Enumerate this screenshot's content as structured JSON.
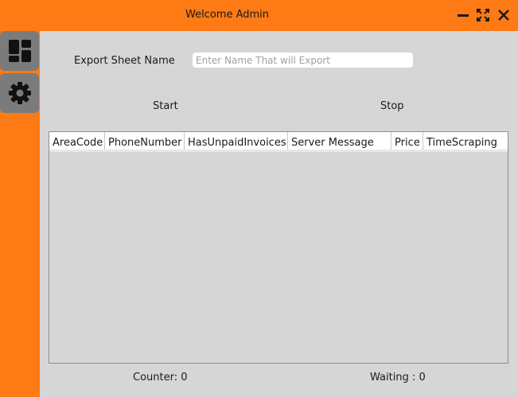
{
  "window": {
    "title": "Welcome Admin",
    "accent_color": "#fd7a14",
    "controls": [
      "minimize-icon",
      "maximize-icon",
      "close-icon"
    ]
  },
  "sidebar": {
    "items": [
      {
        "icon": "dashboard-icon",
        "active": true
      },
      {
        "icon": "gear-icon",
        "active": false
      }
    ]
  },
  "export": {
    "label": "Export Sheet Name",
    "value": "",
    "placeholder": "Enter Name That will Export"
  },
  "actions": {
    "start_label": "Start",
    "stop_label": "Stop"
  },
  "table": {
    "columns": [
      "AreaCode",
      "PhoneNumber",
      "HasUnpaidInvoices",
      "Server Message",
      "Price",
      "TimeScraping"
    ],
    "rows": []
  },
  "status": {
    "counter_label": "Counter: 0",
    "waiting_label": "Waiting : 0"
  }
}
